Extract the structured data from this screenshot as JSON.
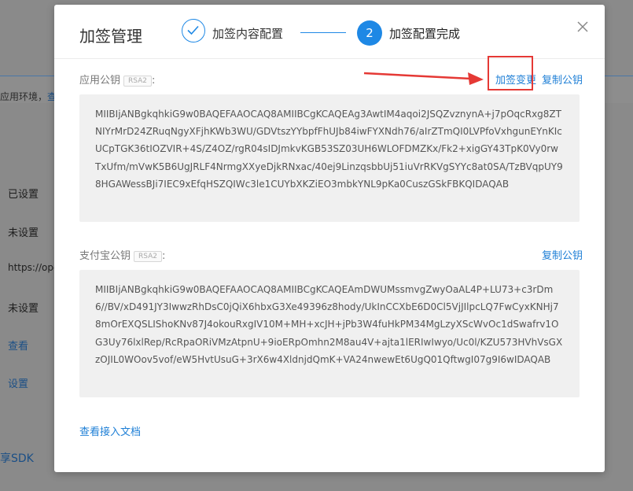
{
  "background": {
    "env_text": "应用环境，",
    "env_link": "查",
    "items": [
      "已设置",
      "未设置",
      "https://ope",
      "未设置",
      "查看",
      "设置"
    ],
    "sdk_text": "享SDK"
  },
  "modal": {
    "title": "加签管理",
    "steps": [
      {
        "label": "加签内容配置",
        "state": "done"
      },
      {
        "number": "2",
        "label": "加签配置完成",
        "state": "active"
      }
    ],
    "app_key": {
      "label": "应用公钥",
      "badge": "RSA2",
      "colon": ":",
      "change_link": "加签变更",
      "copy_link": "复制公钥",
      "value": "MIIBIjANBgkqhkiG9w0BAQEFAAOCAQ8AMIIBCgKCAQEAg3AwtIM4aqoi2JSQZvznynA+j7pOqcRxg8ZTNIYrMrD24ZRuqNgyXFjhKWb3WU/GDVtszYYbpfFhUJb84iwFYXNdh76/aIrZTmQI0LVPfoVxhgunEYnKIcUCpTGK36tIOZVIR+4S/Z4OZ/rgR04sIDJmkvKGB53SZ03UH6WLOFDMZKx/Fk2+xigGY43TpK0Vy0rwTxUfm/mVwK5B6UgJRLF4NrmgXXyeDjkRNxac/40ej9LinzqsbbUj51iuVrRKVgSYYc8at0SA/TzBVqpUY98HGAWessBJi7IEC9xEfqHSZQIWc3le1CUYbXKZiEO3mbkYNL9pKa0CuszGSkFBKQIDAQAB"
    },
    "alipay_key": {
      "label": "支付宝公钥",
      "badge": "RSA2",
      "colon": ":",
      "copy_link": "复制公钥",
      "value": "MIIBIjANBgkqhkiG9w0BAQEFAAOCAQ8AMIIBCgKCAQEAmDWUMssmvgZwyOaAL4P+LU73+c3rDm6//BV/xD491JY3IwwzRhDsC0jQiX6hbxG3Xe49396z8hody/UkInCCXbE6D0Cl5VjJIlpcLQ7FwCyxKNHj78mOrEXQSLIShoKNv87J4okouRxgIV10M+MH+xcJH+jPb3W4fuHkPM34MgLzyXScWvOc1dSwafrv1OG3Uy76lxlRep/RcRpaORiVMzAtpnU+9ioERpOmhn2M8au4V+ajta1lERIwIwyo/Uc0l/KZU573HVhVsGXzOJIL0WOov5vof/eW5HvtUsuG+3rX6w4XldnjdQmK+VA24nwewEt6UgQ01QftwgI07g9I6wIDAQAB"
    },
    "doc_link": "查看接入文档"
  },
  "colors": {
    "accent": "#1e88e5",
    "link": "#1e7fd6",
    "annotation": "#e53935"
  }
}
